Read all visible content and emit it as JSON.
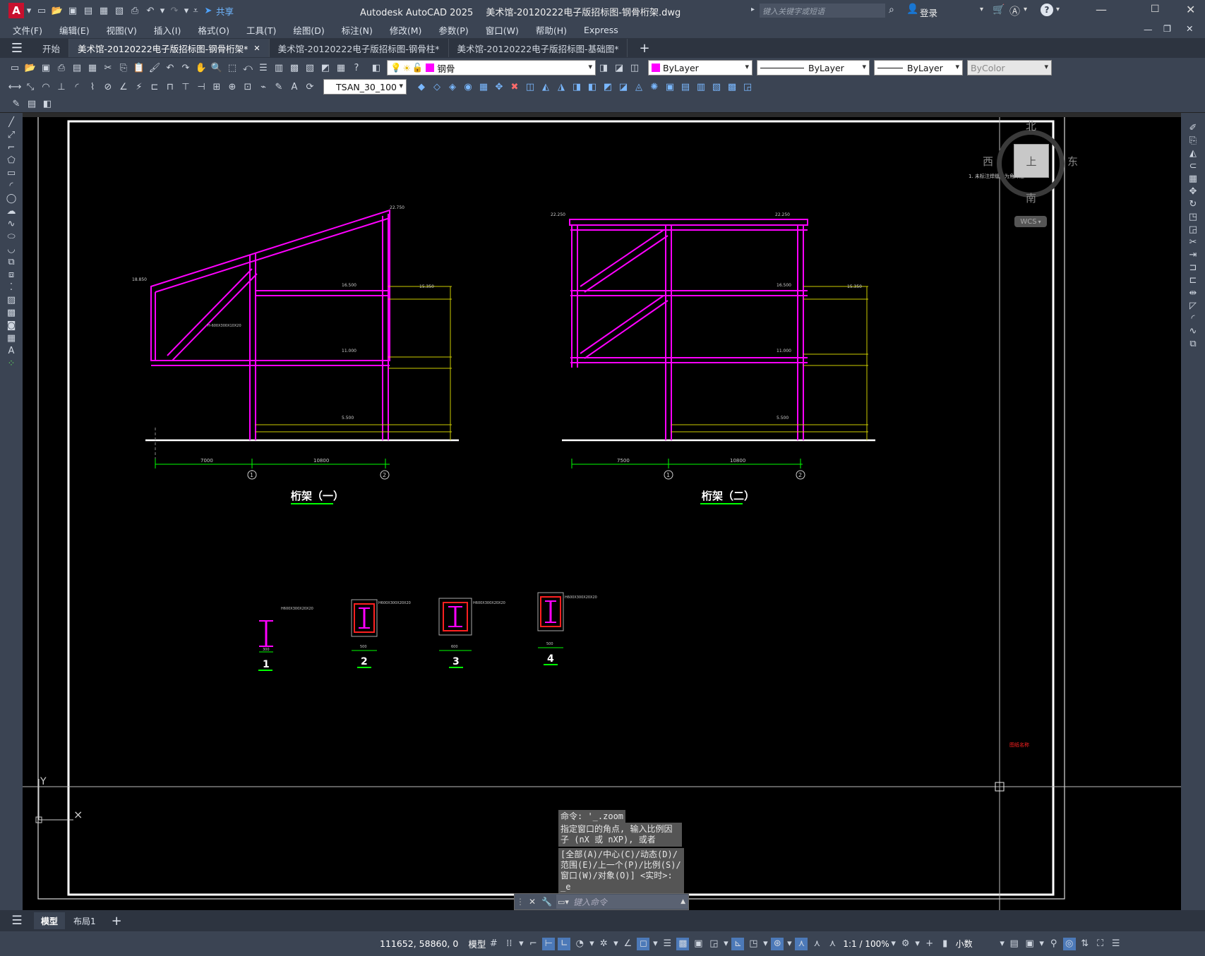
{
  "app": {
    "logo_letter": "A",
    "share_label": "共享",
    "title": "Autodesk AutoCAD 2025",
    "filename": "美术馆-20120222电子版招标图-钢骨桁架.dwg",
    "search_placeholder": "键入关键字或短语",
    "login_label": "登录"
  },
  "menu": [
    "文件(F)",
    "编辑(E)",
    "视图(V)",
    "插入(I)",
    "格式(O)",
    "工具(T)",
    "绘图(D)",
    "标注(N)",
    "修改(M)",
    "参数(P)",
    "窗口(W)",
    "帮助(H)",
    "Express"
  ],
  "doc_tabs": {
    "start": "开始",
    "tabs": [
      {
        "label": "美术馆-20120222电子版招标图-钢骨桁架*",
        "active": true
      },
      {
        "label": "美术馆-20120222电子版招标图-钢骨柱*",
        "active": false
      },
      {
        "label": "美术馆-20120222电子版招标图-基础图*",
        "active": false
      }
    ]
  },
  "properties": {
    "layer": "钢骨",
    "color": "ByLayer",
    "linetype": "ByLayer",
    "lineweight": "ByLayer",
    "plotstyle": "ByColor",
    "dimstyle": "TSAN_30_100"
  },
  "viewcube": {
    "north": "北",
    "south": "南",
    "east": "东",
    "west": "西",
    "top": "上",
    "wcs": "WCS"
  },
  "drawing": {
    "note": "1. 未标注焊缝均为角焊缝hf=6mm",
    "red_label": "图纸名称",
    "truss1": {
      "title": "桁架（一）",
      "dims": [
        "7000",
        "10800"
      ],
      "grid": [
        "1",
        "2"
      ],
      "elev": [
        "18.850",
        "22.750",
        "16.500",
        "15.350",
        "11.000",
        "5.500"
      ],
      "beam_label": "H-600X300X10X20"
    },
    "truss2": {
      "title": "桁架（二）",
      "dims": [
        "7500",
        "10800"
      ],
      "grid": [
        "1",
        "2"
      ],
      "elev": [
        "22.250",
        "22.250",
        "16.500",
        "15.350",
        "11.000",
        "5.500"
      ]
    },
    "sections": [
      {
        "label": "1",
        "text": "H600X300X20X20",
        "dim": "300"
      },
      {
        "label": "2",
        "text": "H600X300X20X20",
        "dim": "500"
      },
      {
        "label": "3",
        "text": "H600X300X20X20",
        "dim": "600"
      },
      {
        "label": "4",
        "text": "H600X300X20X20",
        "dim": "500"
      }
    ]
  },
  "command": {
    "history": [
      "命令: '_.zoom",
      "指定窗口的角点, 输入比例因子 (nX 或 nXP), 或者",
      "[全部(A)/中心(C)/动态(D)/范围(E)/上一个(P)/比例(S)/窗口(W)/对象(O)] <实时>:",
      "_e"
    ],
    "placeholder": "键入命令"
  },
  "layout_tabs": {
    "model": "模型",
    "layout1": "布局1"
  },
  "status": {
    "coords": "111652, 58860, 0",
    "space": "模型",
    "scale": "1:1 / 100%",
    "units": "小数"
  }
}
